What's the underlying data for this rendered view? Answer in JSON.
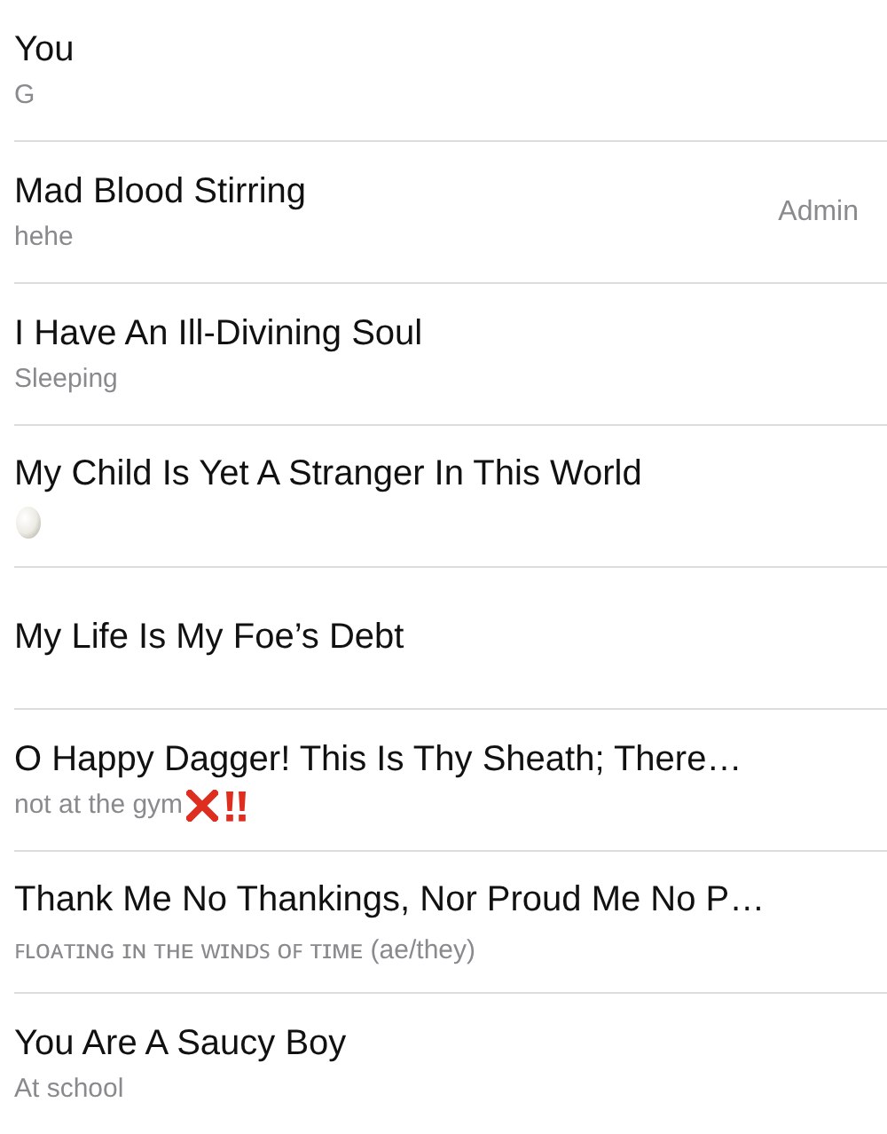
{
  "members": [
    {
      "name": "You",
      "status": "G"
    },
    {
      "name": "Mad Blood Stirring",
      "status": "hehe",
      "role": "Admin"
    },
    {
      "name": "I Have An Ill-Divining Soul",
      "status": "Sleeping"
    },
    {
      "name": "My Child Is Yet A Stranger In This World",
      "status_icons": [
        {
          "kind": "egg"
        }
      ]
    },
    {
      "name": "My Life Is My Foe’s Debt"
    },
    {
      "name": "O Happy Dagger! This Is Thy Sheath; There…",
      "status": "not at the gym",
      "status_icons": [
        {
          "kind": "cross"
        },
        {
          "kind": "bangs"
        }
      ]
    },
    {
      "name": "Thank Me No Thankings, Nor Proud Me No P…",
      "status": "ꜰʟᴏᴀᴛɪɴɢ ɪɴ ᴛʜᴇ ᴡɪɴᴅꜱ ᴏꜰ ᴛɪᴍᴇ (ae/they)"
    },
    {
      "name": "You Are A Saucy Boy",
      "status": "At school"
    }
  ]
}
